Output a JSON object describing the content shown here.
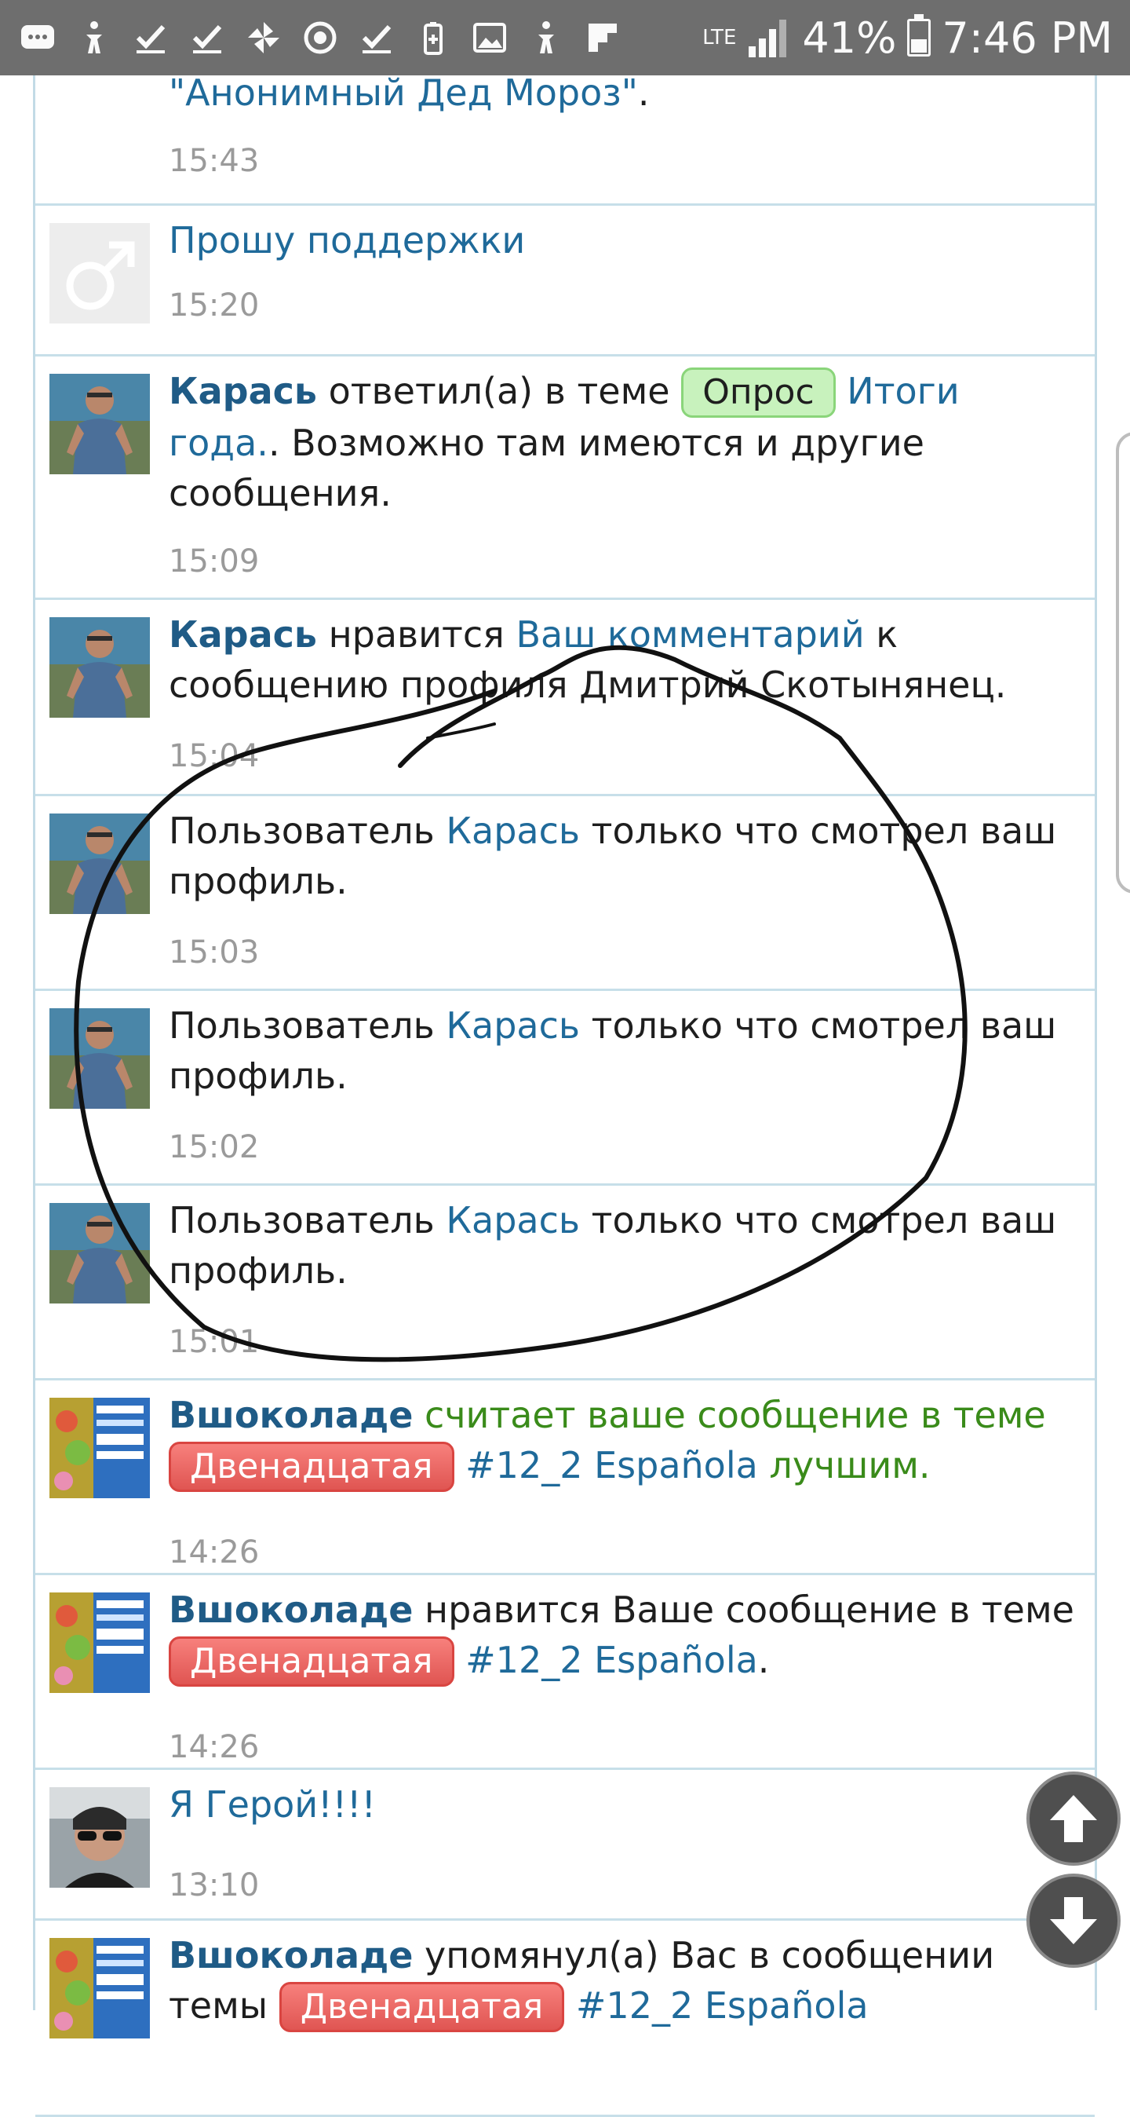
{
  "status_bar": {
    "icons": [
      "message-icon",
      "accessibility-icon",
      "check-icon",
      "check-icon",
      "pinwheel-icon",
      "sync-icon",
      "check-icon",
      "battery-saver-icon",
      "image-icon",
      "accessibility-icon",
      "flipboard-icon"
    ],
    "network": "LTE",
    "battery": "41%",
    "battery_level": 0.41,
    "time": "7:46 PM"
  },
  "feed": [
    {
      "avatar": "avatar-partial",
      "segments": [
        {
          "t": "\"Анонимный Дед Мороз\"",
          "c": "link"
        },
        {
          "t": ".",
          "c": "text"
        }
      ],
      "time": "15:43"
    },
    {
      "avatar": "male-symbol-avatar",
      "segments": [
        {
          "t": "Прошу поддержки",
          "c": "link"
        }
      ],
      "time": "15:20"
    },
    {
      "avatar": "user-photo-karas",
      "segments": [
        {
          "t": "Карась",
          "c": "name"
        },
        {
          "t": " ответил(а) в теме ",
          "c": "text"
        },
        {
          "t": "Опрос",
          "c": "badge-green"
        },
        {
          "t": " Итоги года.",
          "c": "link"
        },
        {
          "t": ". Возможно там имеются и другие сообщения.",
          "c": "text"
        }
      ],
      "time": "15:09"
    },
    {
      "avatar": "user-photo-karas",
      "segments": [
        {
          "t": "Карась",
          "c": "name"
        },
        {
          "t": " нравится ",
          "c": "text"
        },
        {
          "t": "Ваш комментарий",
          "c": "link"
        },
        {
          "t": " к сообщению профиля Дмитрий Скотынянец.",
          "c": "text"
        }
      ],
      "time": "15:04"
    },
    {
      "avatar": "user-photo-karas",
      "segments": [
        {
          "t": "Пользователь ",
          "c": "text"
        },
        {
          "t": "Карась",
          "c": "link"
        },
        {
          "t": " только что смотрел ваш профиль.",
          "c": "text"
        }
      ],
      "time": "15:03"
    },
    {
      "avatar": "user-photo-karas",
      "segments": [
        {
          "t": "Пользователь ",
          "c": "text"
        },
        {
          "t": "Карась",
          "c": "link"
        },
        {
          "t": " только что смотрел ваш профиль.",
          "c": "text"
        }
      ],
      "time": "15:02"
    },
    {
      "avatar": "user-photo-karas",
      "segments": [
        {
          "t": "Пользователь ",
          "c": "text"
        },
        {
          "t": "Карась",
          "c": "link"
        },
        {
          "t": " только что смотрел ваш профиль.",
          "c": "text"
        }
      ],
      "time": "15:01"
    },
    {
      "avatar": "book-cover-vshokolade",
      "segments": [
        {
          "t": "Вшоколаде",
          "c": "name"
        },
        {
          "t": " считает ваше сообщение в теме ",
          "c": "green"
        },
        {
          "t": "Двенадцатая",
          "c": "badge-red"
        },
        {
          "t": " #12_2 Española",
          "c": "link"
        },
        {
          "t": " лучшим.",
          "c": "green"
        }
      ],
      "time": "14:26"
    },
    {
      "avatar": "book-cover-vshokolade",
      "segments": [
        {
          "t": "Вшоколаде",
          "c": "name"
        },
        {
          "t": " нравится Ваше сообщение в теме ",
          "c": "text"
        },
        {
          "t": "Двенадцатая",
          "c": "badge-red"
        },
        {
          "t": " #12_2 Española",
          "c": "link"
        },
        {
          "t": ".",
          "c": "text"
        }
      ],
      "time": "14:26"
    },
    {
      "avatar": "user-photo-sunglasses",
      "segments": [
        {
          "t": "Я Герой!!!!",
          "c": "link"
        }
      ],
      "time": "13:10"
    },
    {
      "avatar": "book-cover-vshokolade",
      "segments": [
        {
          "t": "Вшоколаде",
          "c": "name"
        },
        {
          "t": " упомянул(а) Вас в сообщении темы ",
          "c": "text"
        },
        {
          "t": "Двенадцатая",
          "c": "badge-red"
        },
        {
          "t": " #12_2 Española",
          "c": "link"
        }
      ],
      "time": ""
    }
  ],
  "scroll_controls": {
    "up": "arrow-up-icon",
    "down": "arrow-down-icon"
  },
  "colors": {
    "status_bar": "#6e6e6e",
    "name": "#1f5b86",
    "link": "#1f6a9a",
    "green_text": "#3a8b1a",
    "timestamp": "#9a9a9a",
    "divider": "#c7dfe9",
    "badge_green": "#c8f2bd",
    "badge_red": "#e8605c",
    "doodle": "#111111"
  }
}
